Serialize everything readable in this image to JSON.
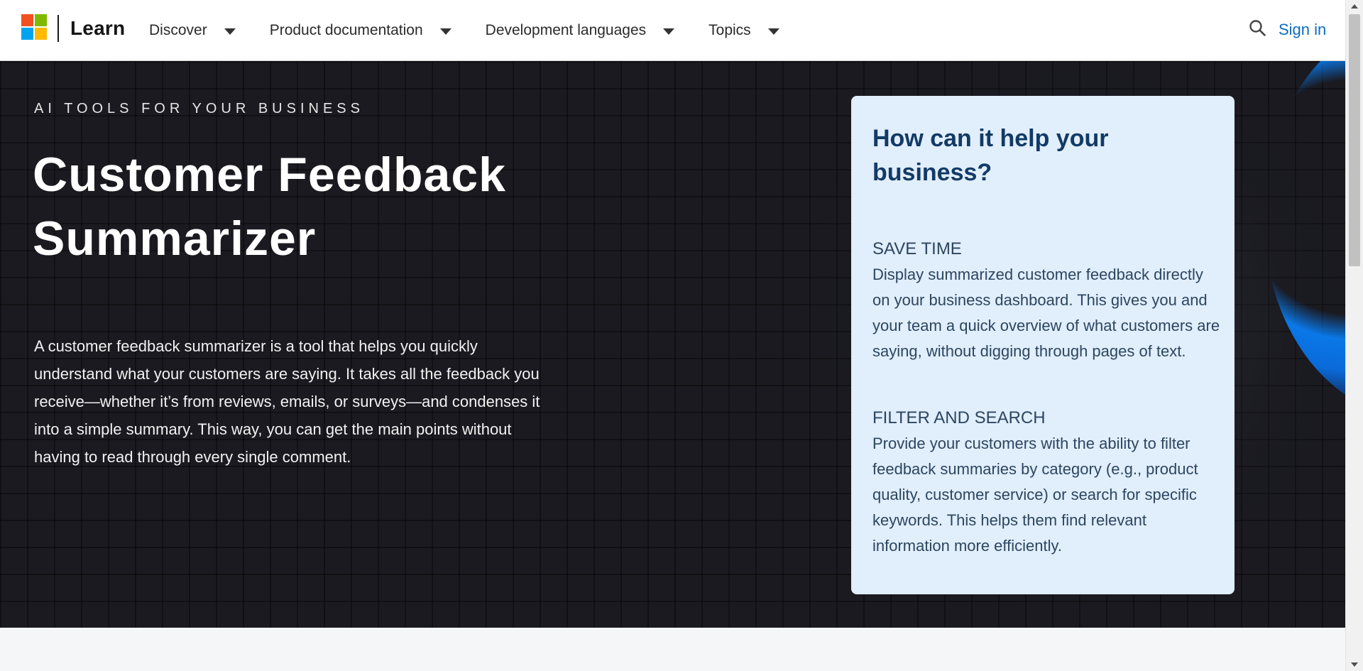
{
  "header": {
    "brand": "Learn",
    "logo_colors": [
      "#f25022",
      "#7fba00",
      "#00a4ef",
      "#ffb900"
    ],
    "nav": [
      {
        "label": "Discover"
      },
      {
        "label": "Product documentation"
      },
      {
        "label": "Development languages"
      },
      {
        "label": "Topics"
      }
    ],
    "search_icon": "search-icon",
    "sign_in": "Sign in"
  },
  "hero": {
    "eyebrow": "AI TOOLS FOR YOUR BUSINESS",
    "title": "Customer Feedback Summarizer",
    "description": "A customer feedback summarizer is a tool that helps you quickly understand what your customers are saying. It takes all the feedback you receive—whether it’s from reviews, emails, or surveys—and condenses it into a simple summary. This way, you can get the main points without having to read through every single comment."
  },
  "card": {
    "title": "How can it help your business?",
    "benefits": [
      {
        "title": "SAVE TIME",
        "text": "Display summarized customer feedback directly on your business dashboard. This gives you and your team a quick overview of what customers are saying, without digging through pages of text."
      },
      {
        "title": "FILTER AND SEARCH",
        "text": "Provide your customers with the ability to filter feedback summaries by category (e.g., product quality, customer service) or search for specific keywords. This helps them find relevant information more efficiently."
      }
    ]
  },
  "colors": {
    "accent_link": "#0f6cbd",
    "hero_background": "#1a1a20",
    "card_background": "#e1eefc",
    "card_heading": "#123a66"
  }
}
